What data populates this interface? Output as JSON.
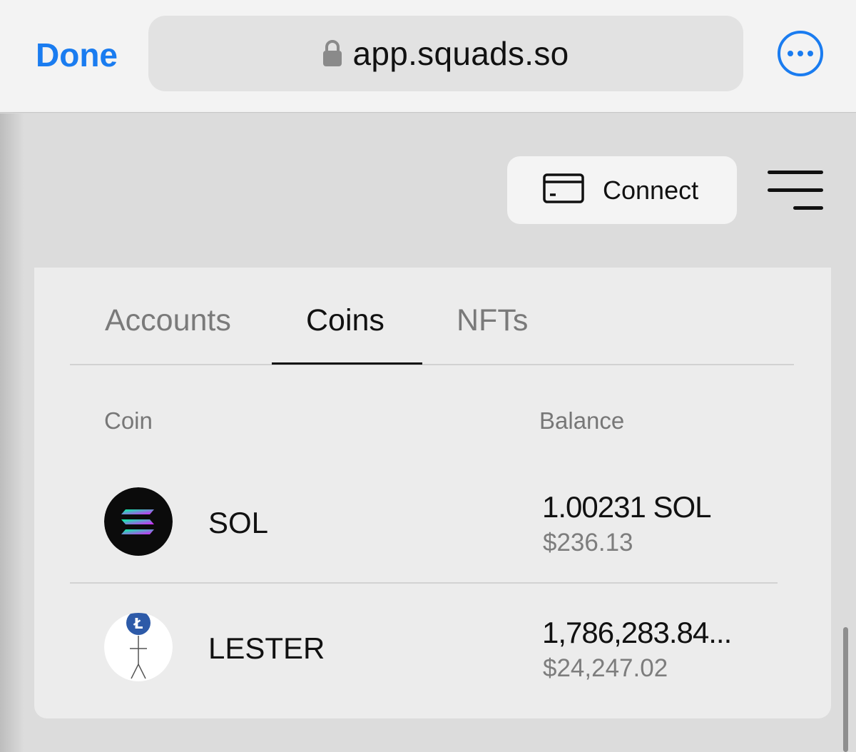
{
  "browser": {
    "done_label": "Done",
    "url": "app.squads.so"
  },
  "header": {
    "connect_label": "Connect"
  },
  "tabs": [
    {
      "label": "Accounts",
      "active": false
    },
    {
      "label": "Coins",
      "active": true
    },
    {
      "label": "NFTs",
      "active": false
    }
  ],
  "table": {
    "columns": [
      "Coin",
      "Balance"
    ],
    "rows": [
      {
        "coin": "SOL",
        "amount": "1.00231 SOL",
        "usd": "$236.13",
        "icon": "solana-logo-icon"
      },
      {
        "coin": "LESTER",
        "amount": "1,786,283.84...",
        "usd": "$24,247.02",
        "icon": "lester-logo-icon"
      }
    ]
  },
  "colors": {
    "accent": "#1a7cf0",
    "text": "#111111",
    "muted": "#7a7a7a"
  }
}
